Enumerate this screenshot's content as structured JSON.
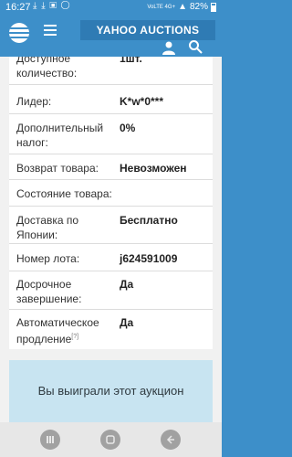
{
  "status_bar": {
    "time": "16:27",
    "notification_icons": [
      "download-icon",
      "download-icon",
      "gallery-icon",
      "whatsapp-icon"
    ],
    "network": "VoLTE 4G+",
    "battery": "82%"
  },
  "header": {
    "brand": "YAHOO AUCTIONS"
  },
  "details": [
    {
      "label": "Доступное количество:",
      "value": "1шт."
    },
    {
      "label": "Лидер:",
      "value": "K*w*0***"
    },
    {
      "label": "Дополнительный налог:",
      "value": "0%"
    },
    {
      "label": "Возврат товара:",
      "value": "Невозможен"
    },
    {
      "label": "Состояние товара:",
      "value": ""
    },
    {
      "label": "Доставка по Японии:",
      "value": "Бесплатно"
    },
    {
      "label": "Номер лота:",
      "value": "j624591009"
    },
    {
      "label": "Досрочное завершение:",
      "value": "Да"
    },
    {
      "label": "Автоматическое продление",
      "note": "[?]",
      "value": "Да"
    }
  ],
  "won_message": "Вы выиграли этот аукцион",
  "colors": {
    "brand_blue": "#3d8fc9",
    "brand_box": "#2f7bb4",
    "won_bg": "#c8e4f1",
    "page_bg": "#f1f1f1"
  }
}
